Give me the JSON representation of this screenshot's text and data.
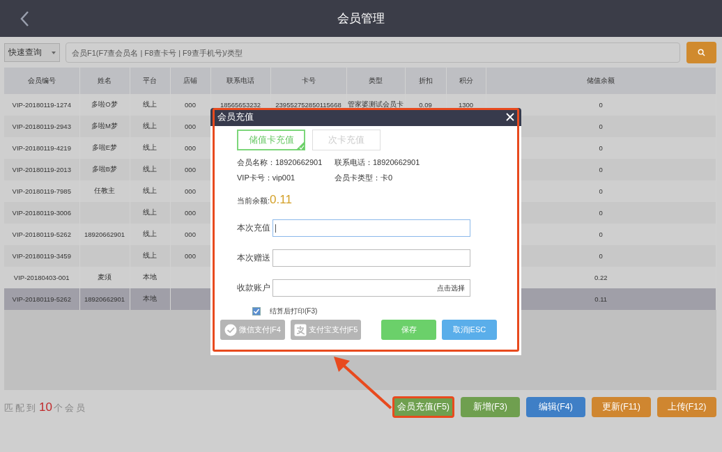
{
  "header": {
    "title": "会员管理"
  },
  "search": {
    "mode": "快速查询",
    "placeholder": "会员F1(F7查会员名 | F8查卡号 | F9查手机号)/类型"
  },
  "table": {
    "columns": [
      "会员编号",
      "姓名",
      "平台",
      "店铺",
      "联系电话",
      "卡号",
      "类型",
      "折扣",
      "积分",
      "储值余额"
    ],
    "rows": [
      {
        "id": "VIP-20180119-1274",
        "name": "多啦O梦",
        "platform": "线上",
        "store": "000",
        "phone": "18565653232",
        "card": "23955275285011566​8",
        "type": "管家婆测试会员卡",
        "discount": "0.09",
        "points": "1300",
        "balance": "0",
        "selected": false
      },
      {
        "id": "VIP-20180119-2943",
        "name": "多啦M梦",
        "platform": "线上",
        "store": "000",
        "balance": "0",
        "selected": false
      },
      {
        "id": "VIP-20180119-4219",
        "name": "多啦E梦",
        "platform": "线上",
        "store": "000",
        "balance": "0",
        "selected": false
      },
      {
        "id": "VIP-20180119-2013",
        "name": "多啦B梦",
        "platform": "线上",
        "store": "000",
        "balance": "0",
        "selected": false
      },
      {
        "id": "VIP-20180119-7985",
        "name": "任教主",
        "platform": "线上",
        "store": "000",
        "balance": "0",
        "selected": false
      },
      {
        "id": "VIP-20180119-3006",
        "platform": "线上",
        "store": "000",
        "balance": "0",
        "selected": false
      },
      {
        "id": "VIP-20180119-5262",
        "name": "18920662901",
        "platform": "线上",
        "store": "000",
        "balance": "0",
        "selected": false
      },
      {
        "id": "VIP-20180119-3459",
        "platform": "线上",
        "store": "000",
        "balance": "0",
        "selected": false
      },
      {
        "id": "VIP-20180403-001",
        "name": "麦须",
        "platform": "本地",
        "balance": "0.22",
        "selected": false
      },
      {
        "id": "VIP-20180119-5262",
        "name": "18920662901",
        "platform": "本地",
        "balance": "0.11",
        "selected": true
      }
    ]
  },
  "footer": {
    "prefix": "匹配到",
    "count": "10",
    "suffix": "个会员",
    "buttons": [
      {
        "label": "会员充值(F5)",
        "color": "#6f9f4f",
        "highlighted": true
      },
      {
        "label": "新增(F3)",
        "color": "#6f9f4f",
        "highlighted": false
      },
      {
        "label": "编辑(F4)",
        "color": "#3f7fc6",
        "highlighted": false
      },
      {
        "label": "更新(F11)",
        "color": "#cf8630",
        "highlighted": false
      },
      {
        "label": "上传(F12)",
        "color": "#cf8630",
        "highlighted": false
      }
    ]
  },
  "dialog": {
    "title": "会员充值",
    "tabs": [
      {
        "label": "储值卡充值",
        "selected": true
      },
      {
        "label": "次卡充值",
        "selected": false
      }
    ],
    "info": [
      "会员名称：18920662901",
      "联系电话：18920662901",
      "VIP卡号：vip001",
      "会员卡类型：卡0"
    ],
    "balance_label": "当前余额:",
    "balance": "0.11",
    "fields": [
      {
        "label": "本次充值",
        "focused": true
      },
      {
        "label": "本次赠送",
        "focused": false
      },
      {
        "label": "收款账户",
        "focused": false,
        "action": "点击选择"
      }
    ],
    "print": {
      "label": "结算后打印(F3)",
      "checked": true
    },
    "buttons": [
      {
        "label": "微信支付|F4",
        "kind": "wechat"
      },
      {
        "label": "支付宝支付|F5",
        "kind": "alipay"
      },
      {
        "label": "保存",
        "kind": "save"
      },
      {
        "label": "取消|ESC",
        "kind": "cancel"
      }
    ]
  }
}
